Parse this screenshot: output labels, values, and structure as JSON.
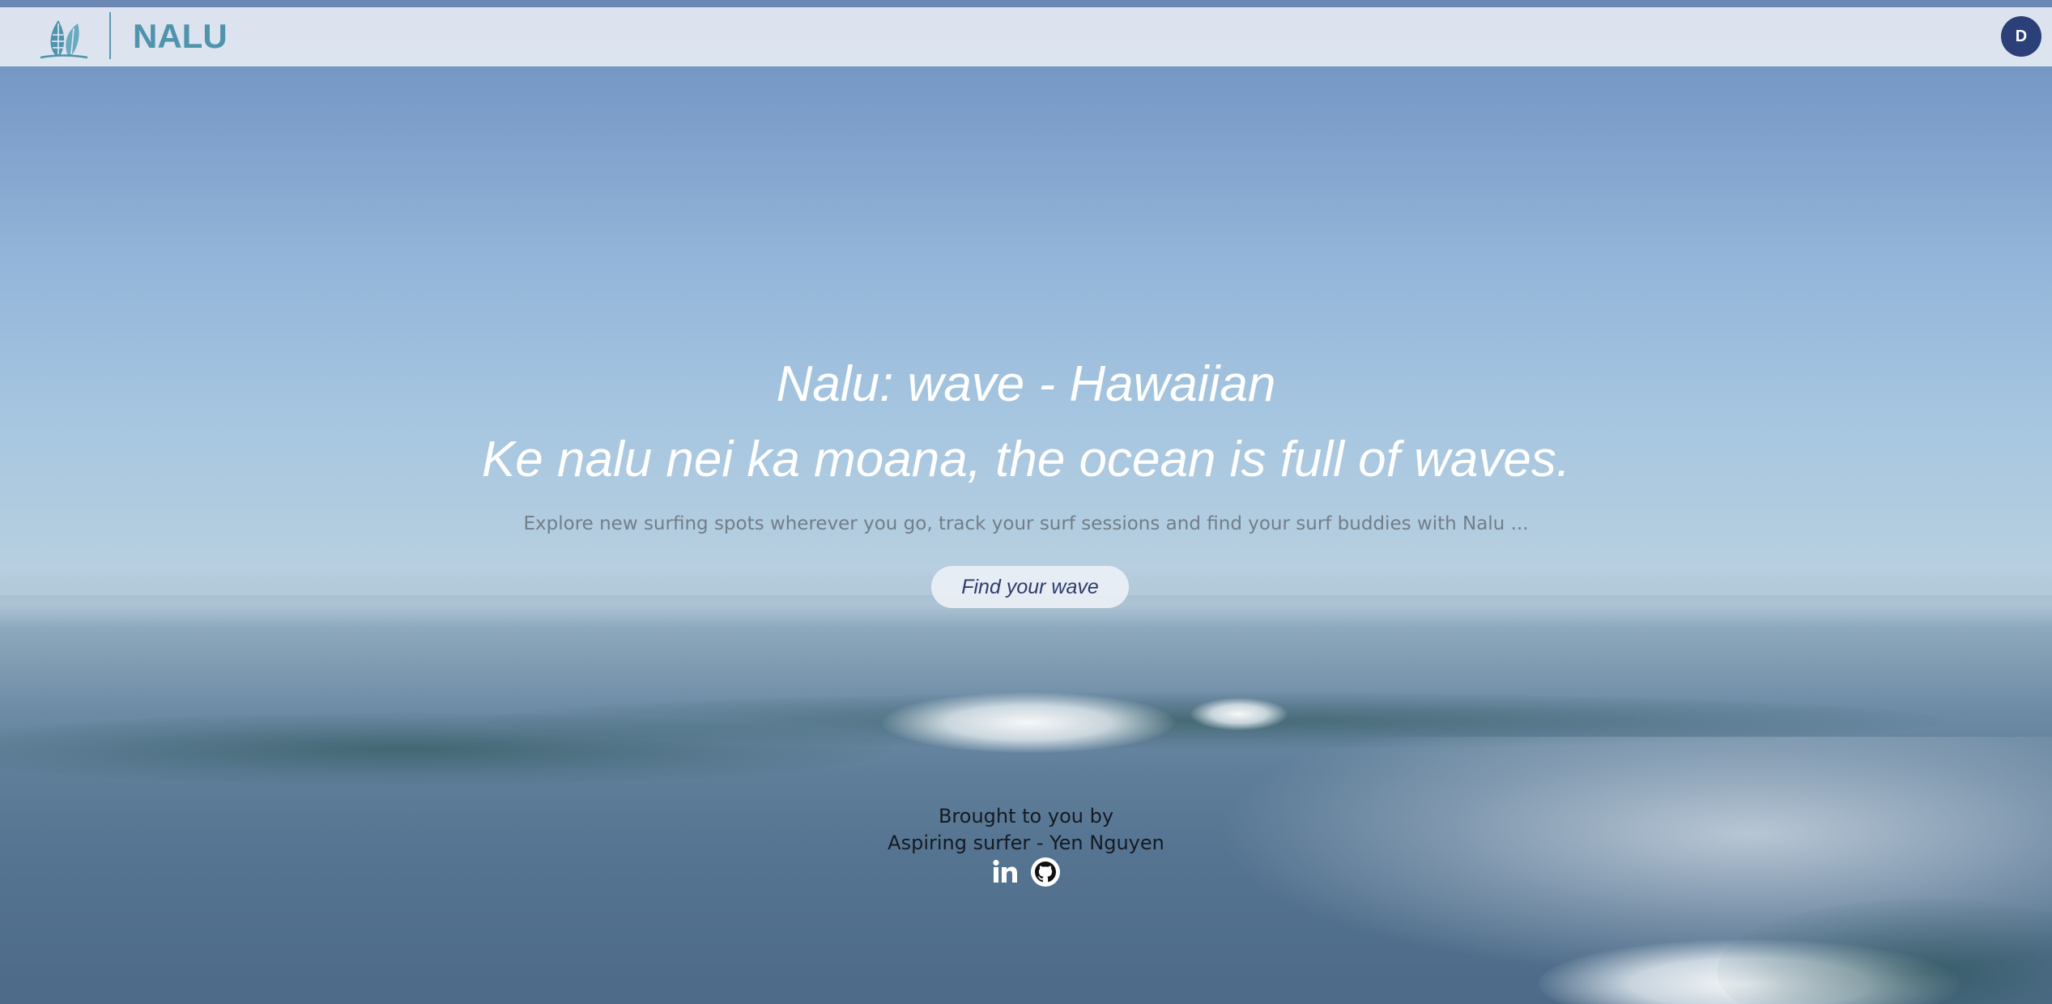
{
  "navbar": {
    "logo_text": "NALU",
    "avatar_initial": "D"
  },
  "hero": {
    "title": "Nalu: wave - Hawaiian",
    "subtitle": "Ke nalu nei ka moana, the ocean is full of waves.",
    "description": "Explore new surfing spots wherever you go, track your surf sessions and find your surf buddies with Nalu ...",
    "cta_label": "Find your wave"
  },
  "credits": {
    "line1": "Brought to you by",
    "line2": "Aspiring surfer - Yen Nguyen",
    "links": [
      {
        "icon": "linkedin-icon"
      },
      {
        "icon": "github-icon"
      }
    ]
  },
  "colors": {
    "navbar_bg": "#e4e9f2",
    "brand": "#4f93ad",
    "avatar_bg": "#2b3f78",
    "cta_text": "#2c3d6e"
  }
}
